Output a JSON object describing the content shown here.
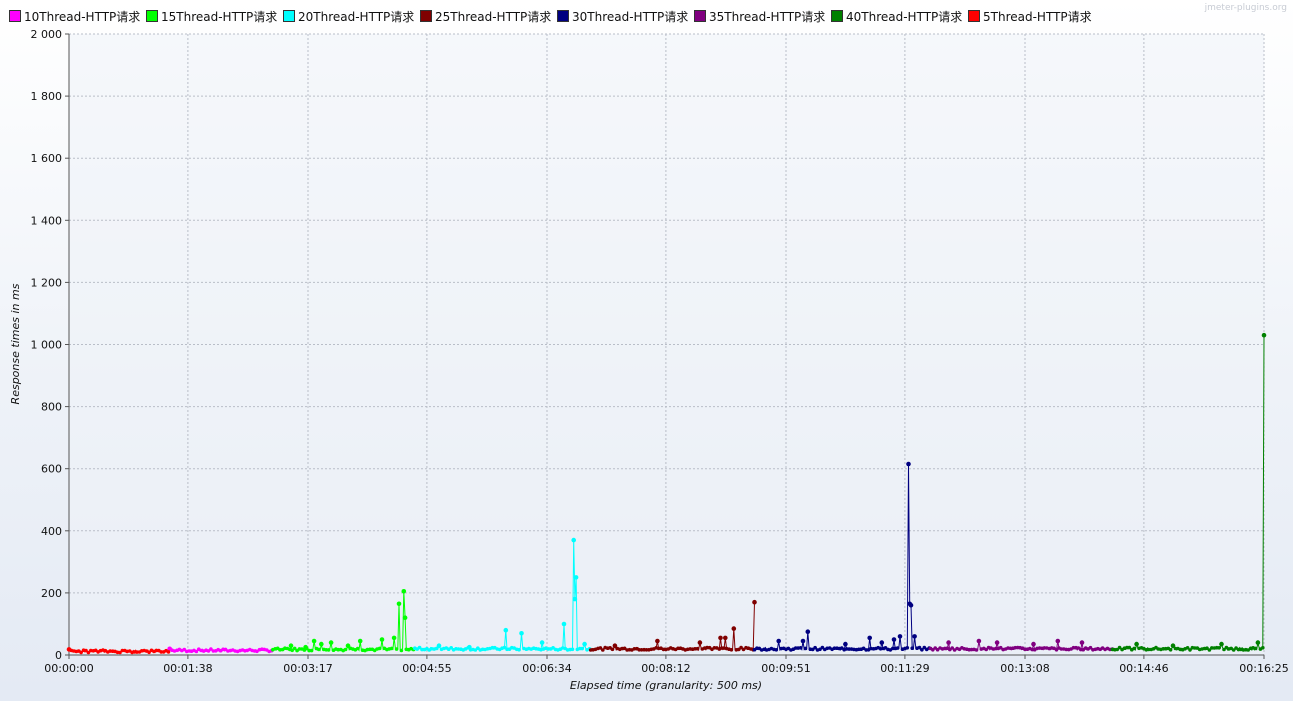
{
  "watermark": "jmeter-plugins.org",
  "chart_data": {
    "type": "line",
    "title": "",
    "xlabel": "Elapsed time (granularity: 500 ms)",
    "ylabel": "Response times in ms",
    "xlim": [
      "00:00:00",
      "00:16:25"
    ],
    "ylim": [
      0,
      2000
    ],
    "y_ticks": [
      "0",
      "200",
      "400",
      "600",
      "800",
      "1 000",
      "1 200",
      "1 400",
      "1 600",
      "1 800",
      "2 000"
    ],
    "x_ticks": [
      "00:00:00",
      "00:01:38",
      "00:03:17",
      "00:04:55",
      "00:06:34",
      "00:08:12",
      "00:09:51",
      "00:11:29",
      "00:13:08",
      "00:14:46",
      "00:16:25"
    ],
    "grid": true,
    "legend_position": "top",
    "series": [
      {
        "name": "10Thread-HTTP请求",
        "color": "#ff00ff",
        "time_range": [
          "00:01:23",
          "00:02:48"
        ],
        "baseline_ms": 15,
        "spikes": [
          {
            "t": "00:01:23",
            "v": 20
          }
        ]
      },
      {
        "name": "15Thread-HTTP请求",
        "color": "#00ff00",
        "time_range": [
          "00:02:48",
          "00:04:45"
        ],
        "baseline_ms": 18,
        "spikes": [
          {
            "t": "00:03:03",
            "v": 30
          },
          {
            "t": "00:03:15",
            "v": 25
          },
          {
            "t": "00:03:22",
            "v": 45
          },
          {
            "t": "00:03:28",
            "v": 35
          },
          {
            "t": "00:03:36",
            "v": 40
          },
          {
            "t": "00:03:50",
            "v": 30
          },
          {
            "t": "00:04:00",
            "v": 45
          },
          {
            "t": "00:04:18",
            "v": 50
          },
          {
            "t": "00:04:28",
            "v": 55
          },
          {
            "t": "00:04:32",
            "v": 165
          },
          {
            "t": "00:04:36",
            "v": 205
          },
          {
            "t": "00:04:37",
            "v": 120
          }
        ]
      },
      {
        "name": "20Thread-HTTP请求",
        "color": "#00ffff",
        "time_range": [
          "00:04:45",
          "00:07:10"
        ],
        "baseline_ms": 20,
        "spikes": [
          {
            "t": "00:05:05",
            "v": 30
          },
          {
            "t": "00:05:30",
            "v": 25
          },
          {
            "t": "00:06:00",
            "v": 80
          },
          {
            "t": "00:06:13",
            "v": 70
          },
          {
            "t": "00:06:30",
            "v": 40
          },
          {
            "t": "00:06:48",
            "v": 100
          },
          {
            "t": "00:06:56",
            "v": 370
          },
          {
            "t": "00:06:57",
            "v": 180
          },
          {
            "t": "00:06:58",
            "v": 250
          },
          {
            "t": "00:07:05",
            "v": 35
          }
        ]
      },
      {
        "name": "25Thread-HTTP请求",
        "color": "#800000",
        "time_range": [
          "00:07:10",
          "00:09:25"
        ],
        "baseline_ms": 20,
        "spikes": [
          {
            "t": "00:07:30",
            "v": 30
          },
          {
            "t": "00:08:05",
            "v": 45
          },
          {
            "t": "00:08:40",
            "v": 40
          },
          {
            "t": "00:08:57",
            "v": 55
          },
          {
            "t": "00:09:01",
            "v": 55
          },
          {
            "t": "00:09:08",
            "v": 85
          },
          {
            "t": "00:09:25",
            "v": 170
          }
        ]
      },
      {
        "name": "30Thread-HTTP请求",
        "color": "#000080",
        "time_range": [
          "00:09:25",
          "00:11:50"
        ],
        "baseline_ms": 20,
        "spikes": [
          {
            "t": "00:09:45",
            "v": 45
          },
          {
            "t": "00:10:05",
            "v": 45
          },
          {
            "t": "00:10:09",
            "v": 75
          },
          {
            "t": "00:10:40",
            "v": 35
          },
          {
            "t": "00:11:00",
            "v": 55
          },
          {
            "t": "00:11:10",
            "v": 40
          },
          {
            "t": "00:11:20",
            "v": 50
          },
          {
            "t": "00:11:25",
            "v": 60
          },
          {
            "t": "00:11:32",
            "v": 615
          },
          {
            "t": "00:11:33",
            "v": 165
          },
          {
            "t": "00:11:34",
            "v": 160
          },
          {
            "t": "00:11:37",
            "v": 60
          }
        ]
      },
      {
        "name": "35Thread-HTTP请求",
        "color": "#800080",
        "time_range": [
          "00:11:50",
          "00:14:20"
        ],
        "baseline_ms": 20,
        "spikes": [
          {
            "t": "00:12:05",
            "v": 40
          },
          {
            "t": "00:12:30",
            "v": 45
          },
          {
            "t": "00:12:45",
            "v": 40
          },
          {
            "t": "00:13:15",
            "v": 35
          },
          {
            "t": "00:13:35",
            "v": 45
          },
          {
            "t": "00:13:55",
            "v": 40
          }
        ]
      },
      {
        "name": "40Thread-HTTP请求",
        "color": "#008000",
        "time_range": [
          "00:14:20",
          "00:16:25"
        ],
        "baseline_ms": 20,
        "spikes": [
          {
            "t": "00:14:40",
            "v": 35
          },
          {
            "t": "00:15:10",
            "v": 30
          },
          {
            "t": "00:15:50",
            "v": 35
          },
          {
            "t": "00:16:20",
            "v": 40
          },
          {
            "t": "00:16:25",
            "v": 1030
          }
        ]
      },
      {
        "name": "5Thread-HTTP请求",
        "color": "#ff0000",
        "time_range": [
          "00:00:00",
          "00:01:23"
        ],
        "baseline_ms": 12,
        "spikes": [
          {
            "t": "00:00:00",
            "v": 18
          }
        ]
      }
    ]
  }
}
